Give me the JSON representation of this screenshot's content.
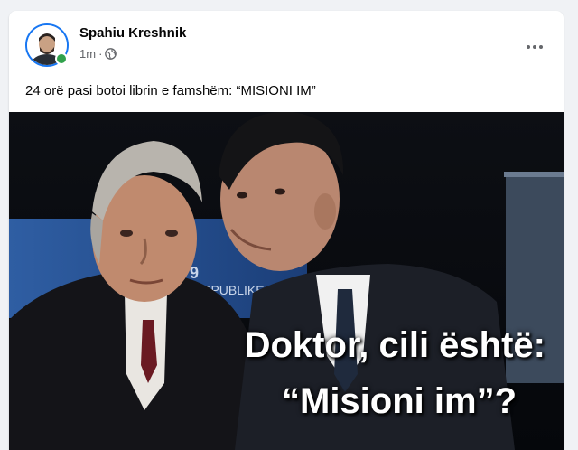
{
  "post": {
    "author": "Spahiu Kreshnik",
    "time": "1m",
    "separator": "·",
    "privacy_icon": "globe-icon",
    "more_icon": "ellipsis-icon",
    "text": "24 orë pasi botoi librin e famshëm: “MISIONI IM”",
    "image": {
      "caption_line_1": "Doktor, cili është:",
      "caption_line_2": "“Misioni im”?",
      "backdrop_text": "REPUBLIKE",
      "backdrop_number": "9"
    }
  },
  "colors": {
    "background": "#f0f2f5",
    "card": "#ffffff",
    "name": "#050505",
    "meta": "#65676b",
    "online": "#31a24c",
    "story_ring": "#1877f2"
  }
}
